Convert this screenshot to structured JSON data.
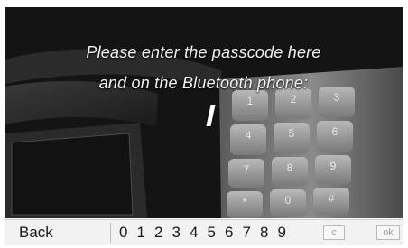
{
  "message": {
    "line1": "Please enter the passcode here",
    "line2": "and on the Bluetooth phone:"
  },
  "bottom_bar": {
    "back_label": "Back",
    "digits": [
      "0",
      "1",
      "2",
      "3",
      "4",
      "5",
      "6",
      "7",
      "8",
      "9"
    ],
    "clear_label": "c",
    "ok_label": "ok"
  },
  "phone_keypad_graphic": {
    "keys": [
      "1",
      "2",
      "3",
      "4",
      "5",
      "6",
      "7",
      "8",
      "9",
      "*",
      "0",
      "#"
    ],
    "letters": [
      "GO",
      "ABC",
      "DEF",
      "GHI",
      "JKL",
      "MNO",
      "PQRS",
      "TUV",
      "WXYZ",
      "",
      "",
      ""
    ]
  },
  "colors": {
    "screen_background": "#141414",
    "message_text": "#f2f2f2",
    "bottom_bar": "#f2f2f2"
  }
}
